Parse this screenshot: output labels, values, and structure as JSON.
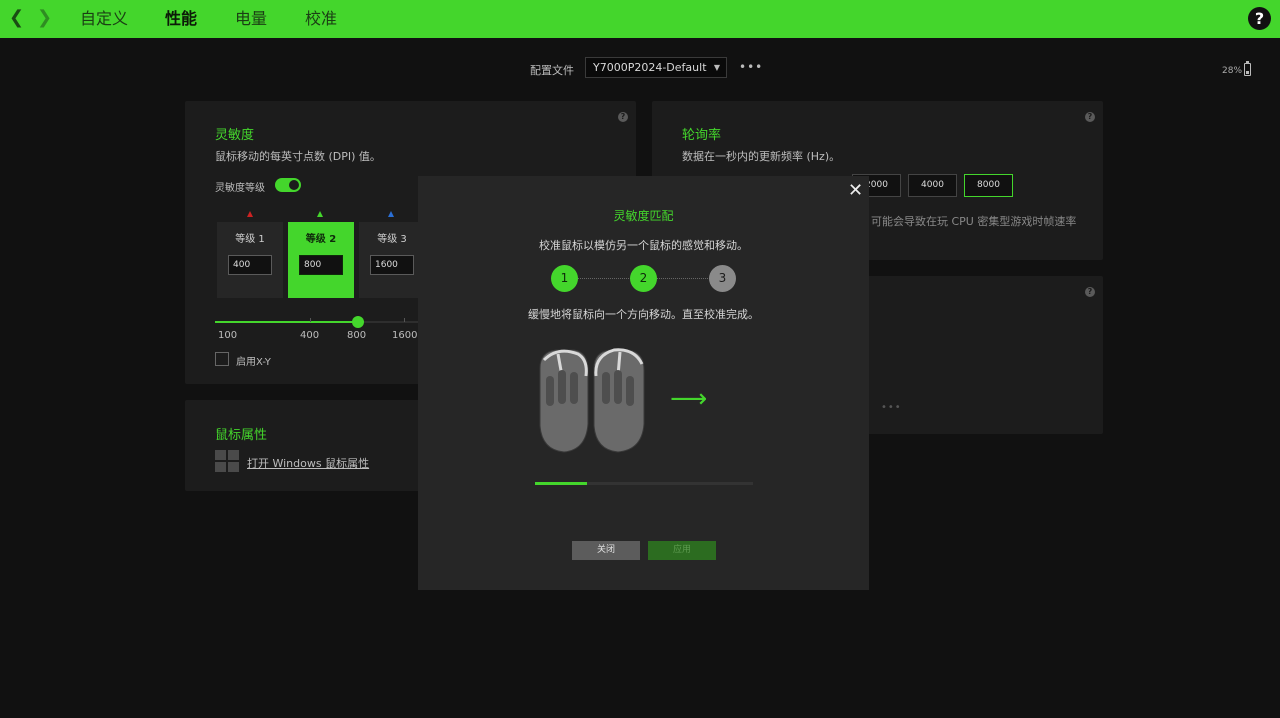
{
  "header": {
    "back_icon": "chevron-left-icon",
    "forward_icon": "chevron-right-icon",
    "tabs": [
      {
        "label": "自定义",
        "active": false
      },
      {
        "label": "性能",
        "active": true
      },
      {
        "label": "电量",
        "active": false
      },
      {
        "label": "校准",
        "active": false
      }
    ],
    "help_label": "?"
  },
  "profile": {
    "label": "配置文件",
    "value": "Y7000P2024-Default",
    "more": "•••"
  },
  "battery": {
    "percent": "28%"
  },
  "sensitivity": {
    "title": "灵敏度",
    "desc": "鼠标移动的每英寸点数 (DPI) 值。",
    "stages_label": "灵敏度等级",
    "stages_enabled": true,
    "stages": [
      {
        "label": "等级 1",
        "value": "400",
        "marker_color": "#cc2222"
      },
      {
        "label": "等级 2",
        "value": "800",
        "marker_color": "#44d62c",
        "active": true
      },
      {
        "label": "等级 3",
        "value": "1600",
        "marker_color": "#2a6fd6"
      }
    ],
    "slider_ticks": [
      "100",
      "400",
      "800",
      "1600"
    ],
    "slider_value": 800,
    "enable_xy_label": "启用X-Y",
    "enable_xy": false
  },
  "mouse_props": {
    "title": "鼠标属性",
    "link": "打开 Windows 鼠标属性",
    "icon": "windows-icon"
  },
  "polling": {
    "title": "轮询率",
    "desc": "数据在一秒内的更新频率 (Hz)。",
    "visible_rates": [
      "2000",
      "4000",
      "8000"
    ],
    "selected": "8000",
    "note": "可能会导致在玩 CPU 密集型游戏时帧速率"
  },
  "card3": {
    "more": "•••"
  },
  "modal": {
    "title": "灵敏度匹配",
    "subtitle": "校准鼠标以模仿另一个鼠标的感觉和移动。",
    "steps": [
      {
        "n": "1",
        "done": true
      },
      {
        "n": "2",
        "done": true
      },
      {
        "n": "3",
        "done": false
      }
    ],
    "instruction": "缓慢地将鼠标向一个方向移动。直至校准完成。",
    "progress": 0.24,
    "close_label": "关闭",
    "apply_label": "应用",
    "close_icon": "close-icon",
    "arrow_icon": "arrow-right-icon"
  },
  "colors": {
    "accent": "#44d62c",
    "background": "#111111",
    "card": "#1c1c1c",
    "modal": "#262626"
  }
}
